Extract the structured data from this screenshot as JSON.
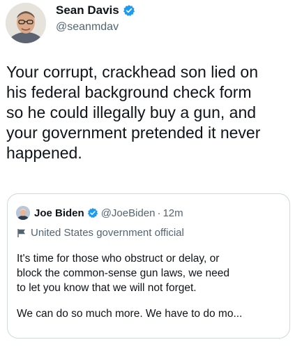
{
  "author": {
    "display_name": "Sean Davis",
    "handle": "@seanmdav"
  },
  "tweet_text_lines": [
    "Your corrupt, crackhead son lied on",
    "his federal background check form",
    "so he could illegally buy a gun, and",
    "your government pretended it never",
    "happened."
  ],
  "quoted": {
    "display_name": "Joe Biden",
    "handle": "@JoeBiden",
    "separator": "·",
    "time": "12m",
    "label": "United States government official",
    "text_lines": [
      "It's time for those who obstruct or delay, or",
      "block the common-sense gun laws, we need",
      "to let you know that we will not forget."
    ],
    "text_line2": "We can do so much more. We have to do mo..."
  },
  "icons": {
    "verified": "verified-badge-icon",
    "government_label": "flag-icon"
  },
  "colors": {
    "verified_blue": "#1d9bf0",
    "text_primary": "#0f1419",
    "text_secondary": "#536471",
    "border": "#cfd9de"
  }
}
